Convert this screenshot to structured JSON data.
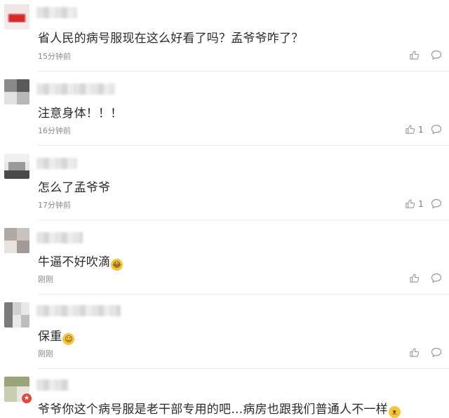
{
  "comments": [
    {
      "text": "省人民的病号服现在这么好看了吗？孟爷爷咋了？",
      "time": "15分钟前",
      "likes": "",
      "emoji": "",
      "badge": false
    },
    {
      "text": "注意身体！！！",
      "time": "16分钟前",
      "likes": "1",
      "emoji": "",
      "badge": false
    },
    {
      "text": "怎么了孟爷爷",
      "time": "17分钟前",
      "likes": "1",
      "emoji": "",
      "badge": false
    },
    {
      "text": "牛逼不好吹滴",
      "time": "刚刚",
      "likes": "",
      "emoji": "laugh-cry-emoji",
      "badge": false
    },
    {
      "text": "保重",
      "time": "刚刚",
      "likes": "",
      "emoji": "smile-emoji",
      "badge": false
    },
    {
      "text": "爷爷你这个病号服是老干部专用的吧…病房也跟我们普通人不一样",
      "time": "",
      "likes": "",
      "emoji": "cat-face-emoji",
      "badge": true
    }
  ],
  "colors": {
    "text": "#2a2a2a",
    "meta": "#8a8a8a",
    "divider": "#ececec",
    "icon": "#999999",
    "badge": "#e2473b"
  },
  "icons": {
    "like": "thumbs-up-icon",
    "reply": "speech-bubble-icon"
  }
}
